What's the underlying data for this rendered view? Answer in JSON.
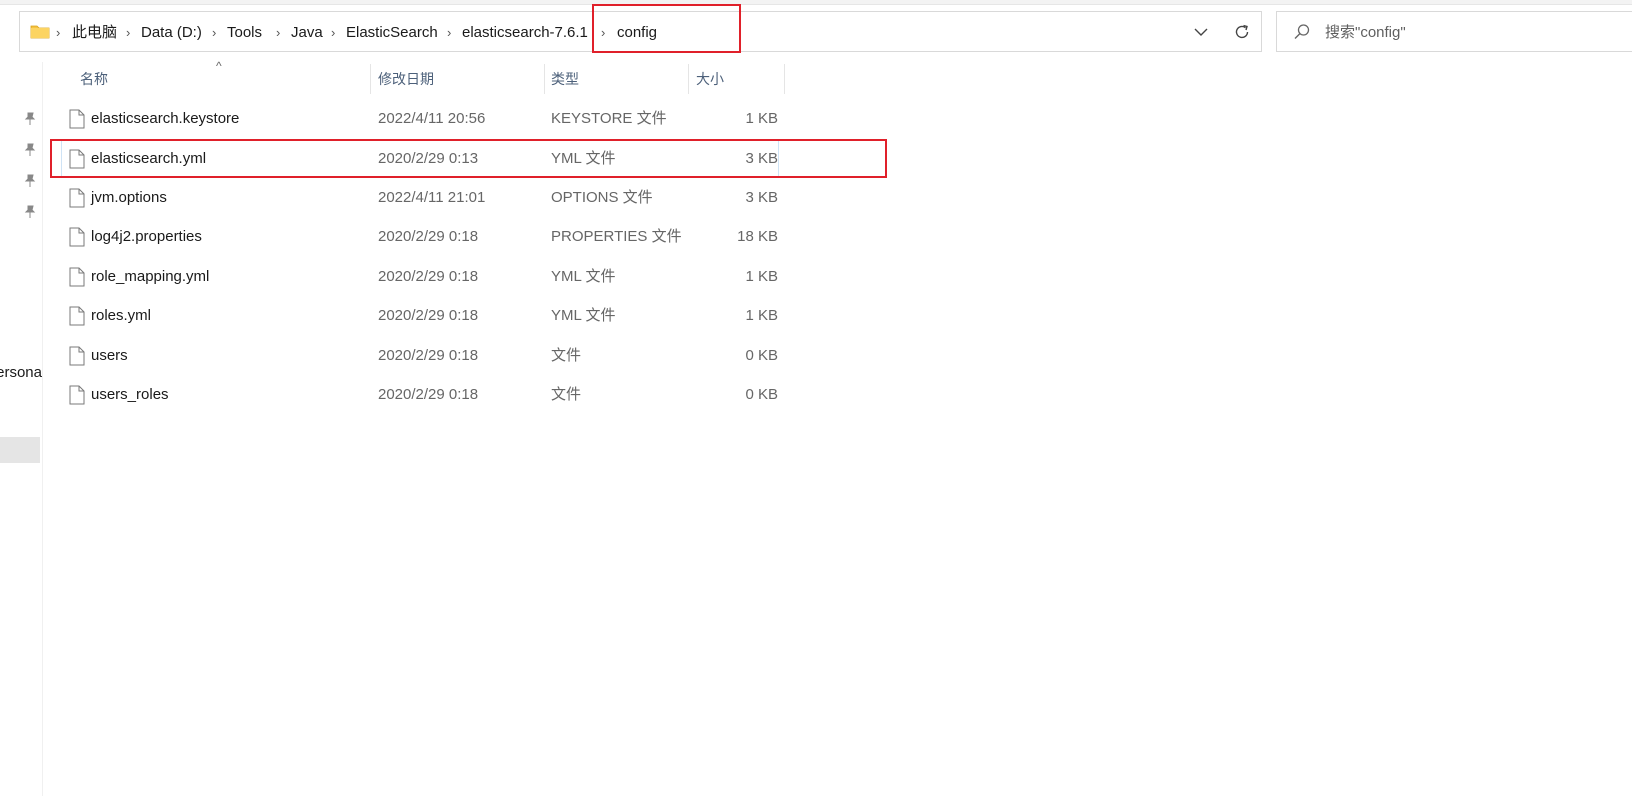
{
  "breadcrumb": {
    "items": [
      {
        "label": "此电脑"
      },
      {
        "label": "Data (D:)"
      },
      {
        "label": "Tools"
      },
      {
        "label": "Java"
      },
      {
        "label": "ElasticSearch"
      },
      {
        "label": "elasticsearch-7.6.1"
      },
      {
        "label": "config"
      }
    ],
    "separator": "›"
  },
  "search": {
    "placeholder": "搜索\"config\""
  },
  "nav": {
    "partial_label": "ersona"
  },
  "columns": {
    "name": "名称",
    "date": "修改日期",
    "type": "类型",
    "size": "大小",
    "sort_indicator": "^"
  },
  "files": [
    {
      "name": "elasticsearch.keystore",
      "date": "2022/4/11 20:56",
      "type": "KEYSTORE 文件",
      "size": "1 KB"
    },
    {
      "name": "elasticsearch.yml",
      "date": "2020/2/29 0:13",
      "type": "YML 文件",
      "size": "3 KB"
    },
    {
      "name": "jvm.options",
      "date": "2022/4/11 21:01",
      "type": "OPTIONS 文件",
      "size": "3 KB"
    },
    {
      "name": "log4j2.properties",
      "date": "2020/2/29 0:18",
      "type": "PROPERTIES 文件",
      "size": "18 KB"
    },
    {
      "name": "role_mapping.yml",
      "date": "2020/2/29 0:18",
      "type": "YML 文件",
      "size": "1 KB"
    },
    {
      "name": "roles.yml",
      "date": "2020/2/29 0:18",
      "type": "YML 文件",
      "size": "1 KB"
    },
    {
      "name": "users",
      "date": "2020/2/29 0:18",
      "type": "文件",
      "size": "0 KB"
    },
    {
      "name": "users_roles",
      "date": "2020/2/29 0:18",
      "type": "文件",
      "size": "0 KB"
    }
  ],
  "colors": {
    "annotation": "#e0202a",
    "folder": "#f5c342",
    "header_text": "#4c607a"
  }
}
